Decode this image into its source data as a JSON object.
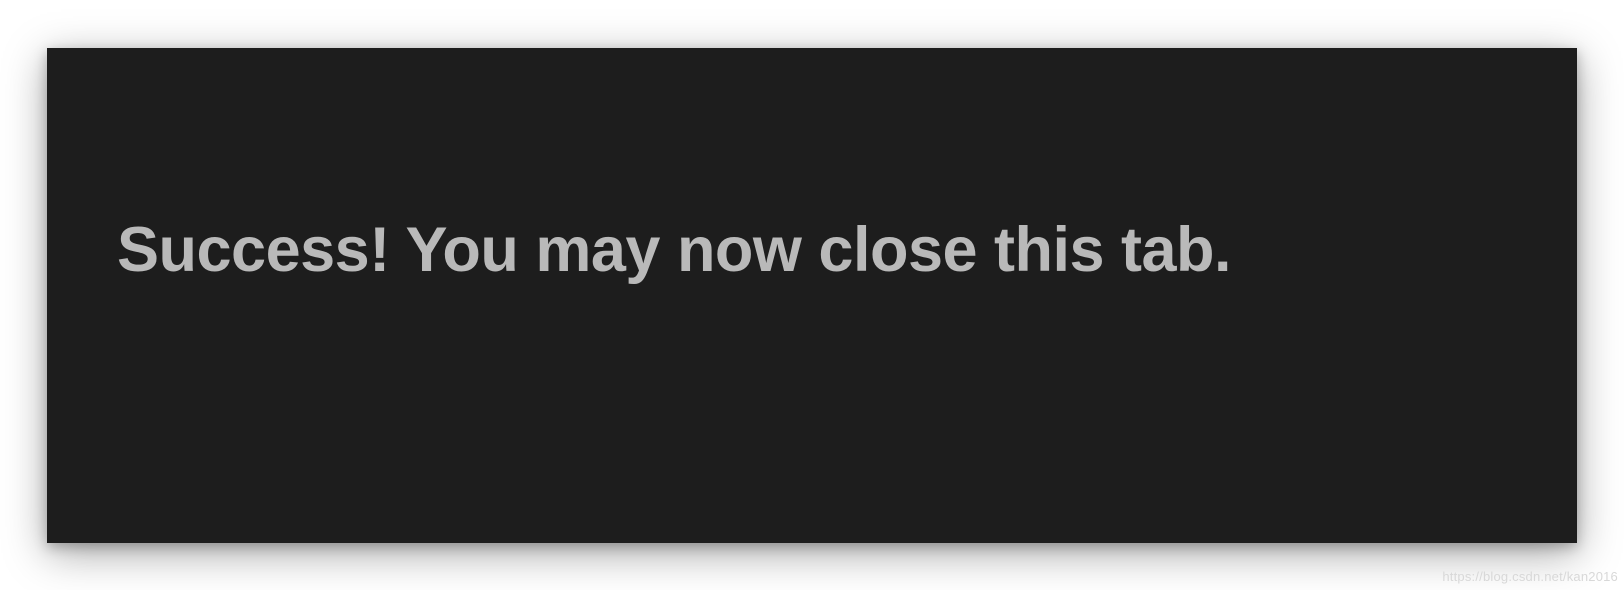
{
  "main": {
    "message": "Success! You may now close this tab."
  },
  "watermark": {
    "text": "https://blog.csdn.net/kan2016"
  },
  "colors": {
    "panel_bg": "#1d1d1d",
    "text": "#b9b9b9"
  }
}
